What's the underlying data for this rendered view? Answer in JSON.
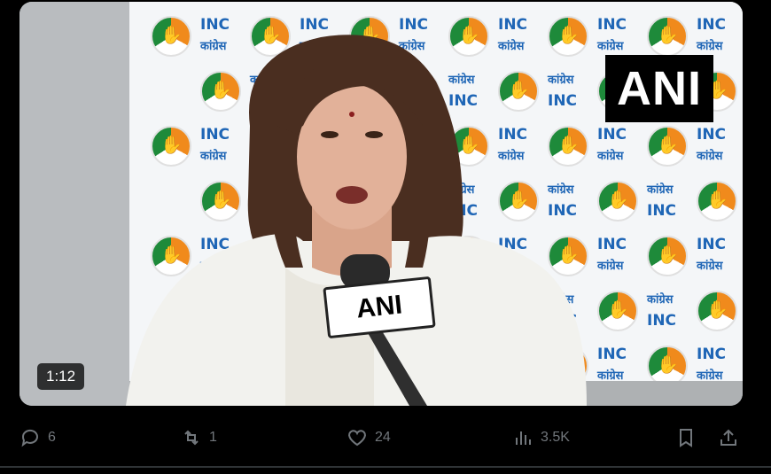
{
  "video": {
    "timestamp": "1:12",
    "broadcaster_badge": "ANI",
    "mic_label": "ANI",
    "backdrop_text_en": "INC",
    "backdrop_text_hi": "कांग्रेस"
  },
  "actions": {
    "replies": "6",
    "reposts": "1",
    "likes": "24",
    "views": "3.5K"
  },
  "colors": {
    "background": "#000000",
    "backdrop_text": "#1f66b6",
    "action_icon": "#71767b"
  },
  "icons": [
    "reply-icon",
    "repost-icon",
    "like-icon",
    "views-icon",
    "bookmark-icon",
    "share-icon"
  ]
}
